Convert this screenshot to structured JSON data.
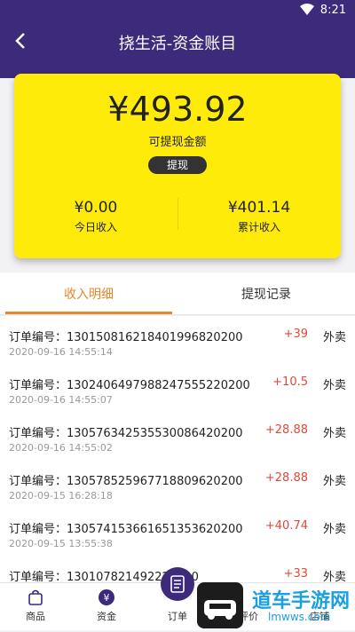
{
  "status_bar": {
    "time": "8:21"
  },
  "nav": {
    "title": "挠生活-资金账目"
  },
  "balance": {
    "amount": "¥493.92",
    "label": "可提现金额",
    "withdraw_button": "提现"
  },
  "stats": {
    "today": {
      "value": "¥0.00",
      "label": "今日收入"
    },
    "total": {
      "value": "¥401.14",
      "label": "累计收入"
    }
  },
  "tabs": [
    {
      "label": "收入明细",
      "active": true
    },
    {
      "label": "提现记录",
      "active": false
    }
  ],
  "records": [
    {
      "order": "订单编号：1301508162184019968202​00",
      "time": "2020-09-16 14:55:14",
      "amount": "+39",
      "type": "外卖"
    },
    {
      "order": "订单编号：1302406497988247555220200",
      "time": "2020-09-16 14:55:07",
      "amount": "+10.5",
      "type": "外卖"
    },
    {
      "order": "订单编号：1305763425355300864202​00",
      "time": "2020-09-16 14:55:02",
      "amount": "+28.88",
      "type": "外卖"
    },
    {
      "order": "订单编号：1305785259677188096202​00",
      "time": "2020-09-15 16:28:18",
      "amount": "+28.88",
      "type": "外卖"
    },
    {
      "order": "订单编号：1305741536616513536202​00",
      "time": "2020-09-15 13:55:38",
      "amount": "+40.74",
      "type": "外卖"
    },
    {
      "order": "订单编号：130107821492​​220200",
      "time": "",
      "amount": "+33",
      "type": "外卖"
    }
  ],
  "bottom_nav": [
    {
      "label": "商品",
      "icon": "bag-icon"
    },
    {
      "label": "资金",
      "icon": "yen-icon"
    },
    {
      "label": "订单",
      "icon": "list-icon"
    },
    {
      "label": "评价",
      "icon": "thumb-icon"
    },
    {
      "label": "店铺",
      "icon": "store-icon"
    }
  ],
  "watermark": {
    "text": "道车手游网",
    "url": "lmwws.com"
  },
  "colors": {
    "header": "#3d2a7a",
    "card": "#ffeb0a",
    "accent": "#e5872b",
    "amount": "#e04a3a"
  }
}
